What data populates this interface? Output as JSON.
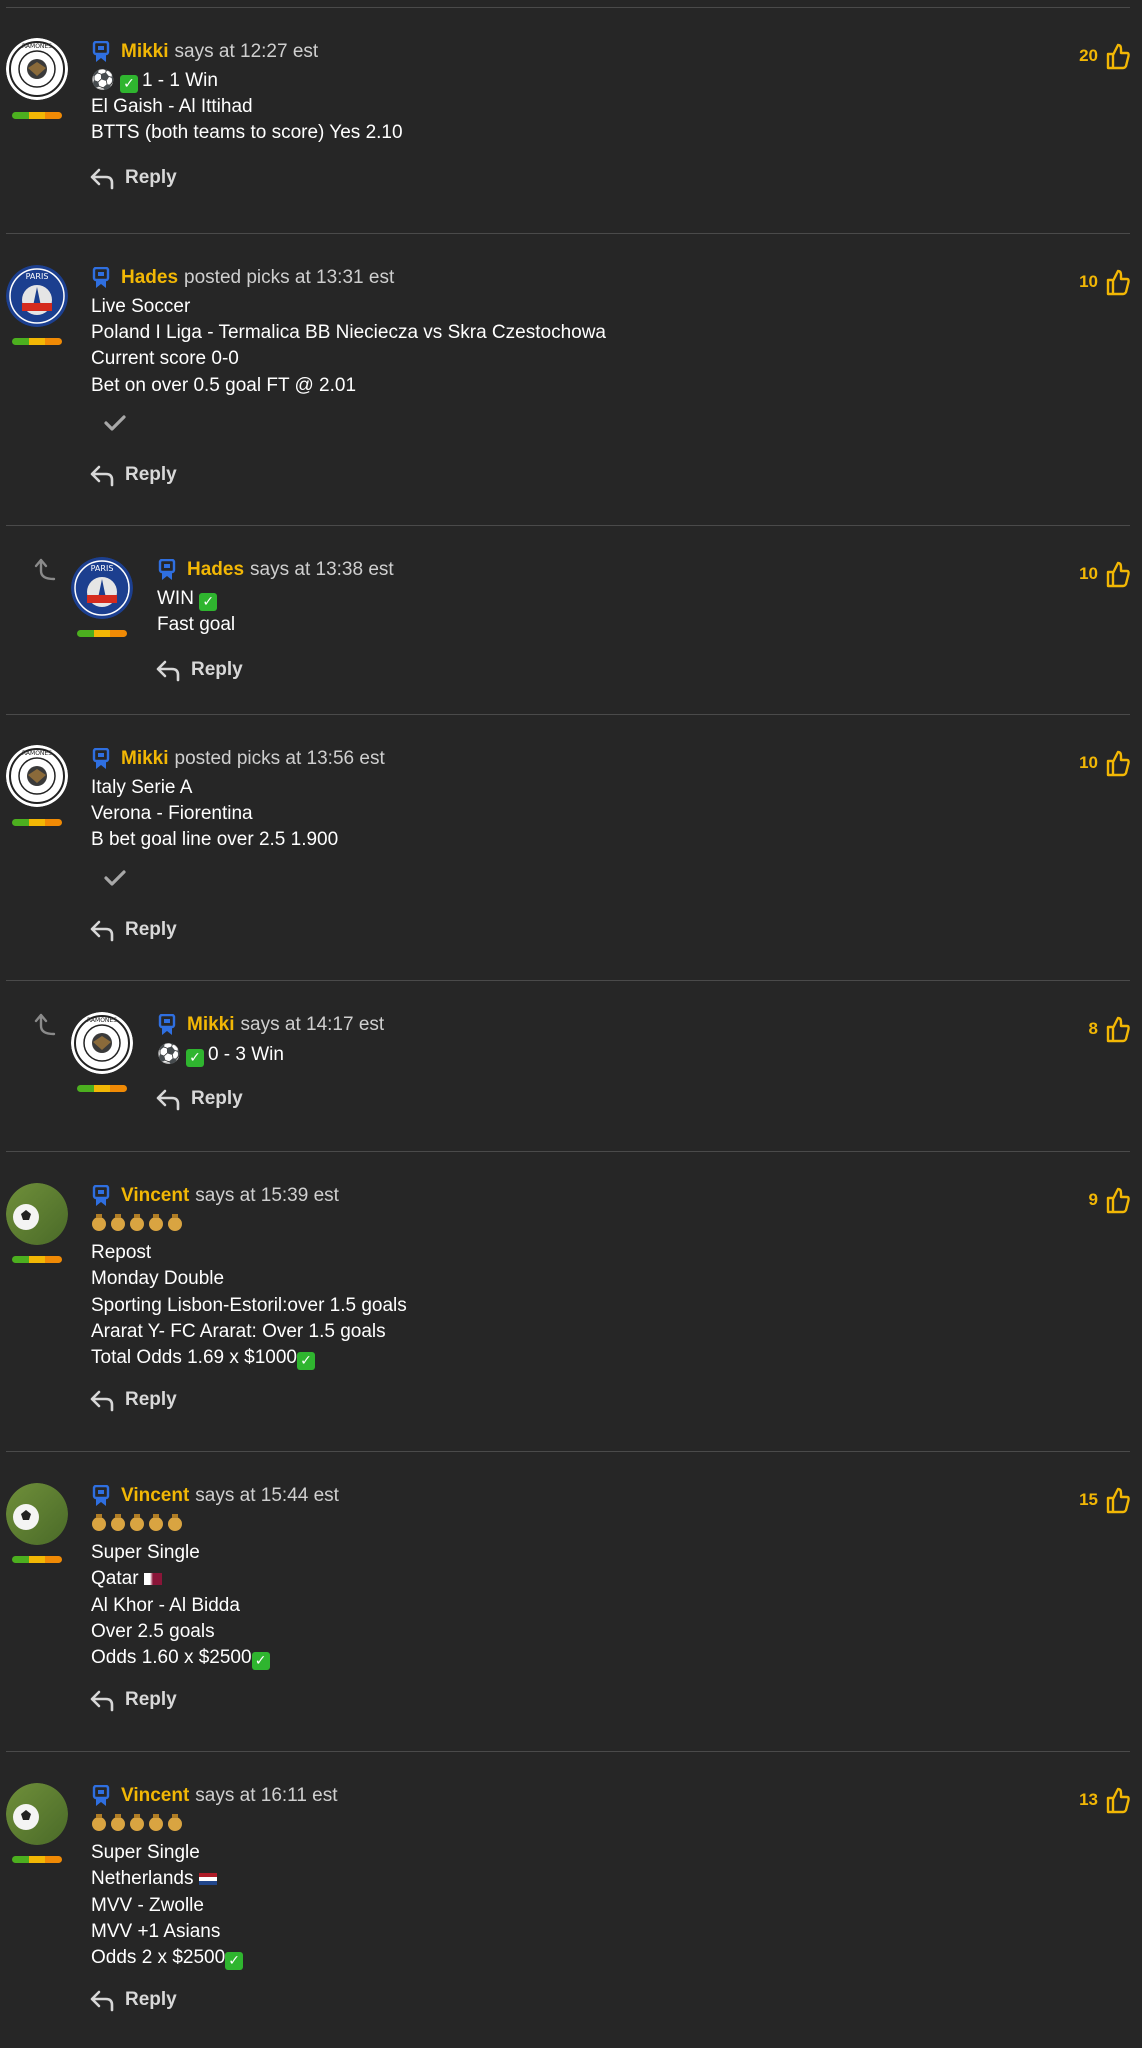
{
  "comments": [
    {
      "user": "Mikki",
      "action": "says at 12:27 est",
      "likes": "20",
      "lines": [
        "1 - 1 Win",
        "El Gaish - Al Ittihad",
        "BTTS (both teams to score) Yes 2.10"
      ],
      "reply_label": "Reply"
    },
    {
      "user": "Hades",
      "action": "posted picks at 13:31 est",
      "likes": "10",
      "lines": [
        "Live Soccer",
        "Poland I Liga - Termalica BB Nieciecza vs Skra Czestochowa",
        "Current score 0-0",
        "Bet on over 0.5 goal FT @ 2.01"
      ],
      "reply_label": "Reply"
    },
    {
      "user": "Hades",
      "action": "says at 13:38 est",
      "likes": "10",
      "lines": [
        "WIN",
        "Fast goal"
      ],
      "reply_label": "Reply"
    },
    {
      "user": "Mikki",
      "action": "posted picks at 13:56 est",
      "likes": "10",
      "lines": [
        "Italy Serie A",
        "Verona - Fiorentina",
        "B bet goal line over 2.5 1.900"
      ],
      "reply_label": "Reply"
    },
    {
      "user": "Mikki",
      "action": "says at 14:17 est",
      "likes": "8",
      "lines": [
        "0 - 3 Win"
      ],
      "reply_label": "Reply"
    },
    {
      "user": "Vincent",
      "action": "says at 15:39 est",
      "likes": "9",
      "lines": [
        "Repost",
        "Monday Double",
        "Sporting Lisbon-Estoril:over 1.5 goals",
        "Ararat Y- FC Ararat: Over 1.5 goals",
        "Total Odds 1.69 x $1000"
      ],
      "reply_label": "Reply"
    },
    {
      "user": "Vincent",
      "action": "says at 15:44 est",
      "likes": "15",
      "lines": [
        "Super Single",
        "Qatar",
        "Al Khor - Al Bidda",
        "Over 2.5 goals",
        "Odds 1.60 x $2500"
      ],
      "reply_label": "Reply"
    },
    {
      "user": "Vincent",
      "action": "says at 16:11 est",
      "likes": "13",
      "lines": [
        "Super Single",
        "Netherlands",
        "MVV - Zwolle",
        "MVV +1 Asians",
        "Odds 2 x $2500"
      ],
      "reply_label": "Reply"
    }
  ],
  "colors": {
    "background": "#262626",
    "username": "#f2b705",
    "likes": "#f2b705",
    "badge": "#2f6fe0",
    "check": "#2fb52f"
  },
  "icons": {
    "badge": "blue-badge-icon",
    "like": "thumbs-up-icon",
    "reply": "reply-arrow-icon",
    "nested": "nested-reply-arrow-icon",
    "tick": "checkmark-icon"
  }
}
